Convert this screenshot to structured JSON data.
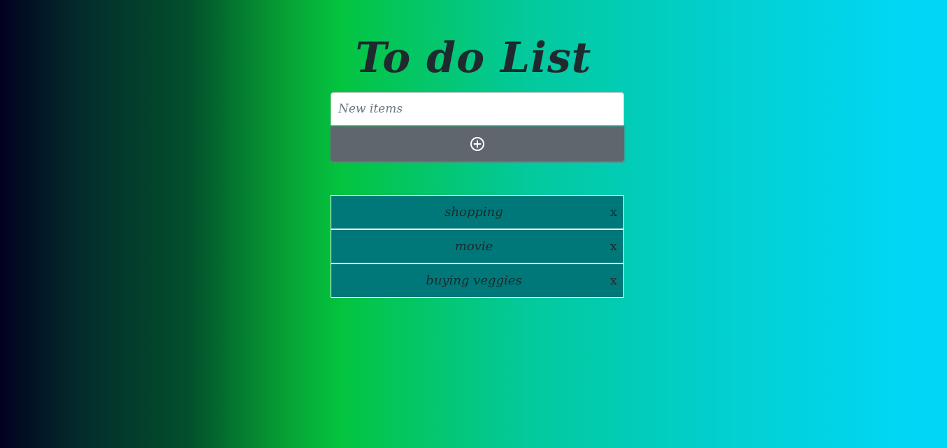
{
  "app": {
    "title": "To do List"
  },
  "form": {
    "input_value": "",
    "input_placeholder": "New items",
    "add_icon": "plus-circle-icon"
  },
  "todos": [
    {
      "text": "shopping",
      "delete_label": "x"
    },
    {
      "text": "movie",
      "delete_label": "x"
    },
    {
      "text": "buying veggies",
      "delete_label": "x"
    }
  ],
  "colors": {
    "item_background": "#00787a",
    "button_background": "#5f666d",
    "gradient_start": "#02011f",
    "gradient_mid": "#04c43f",
    "gradient_end": "#01d6f7"
  }
}
